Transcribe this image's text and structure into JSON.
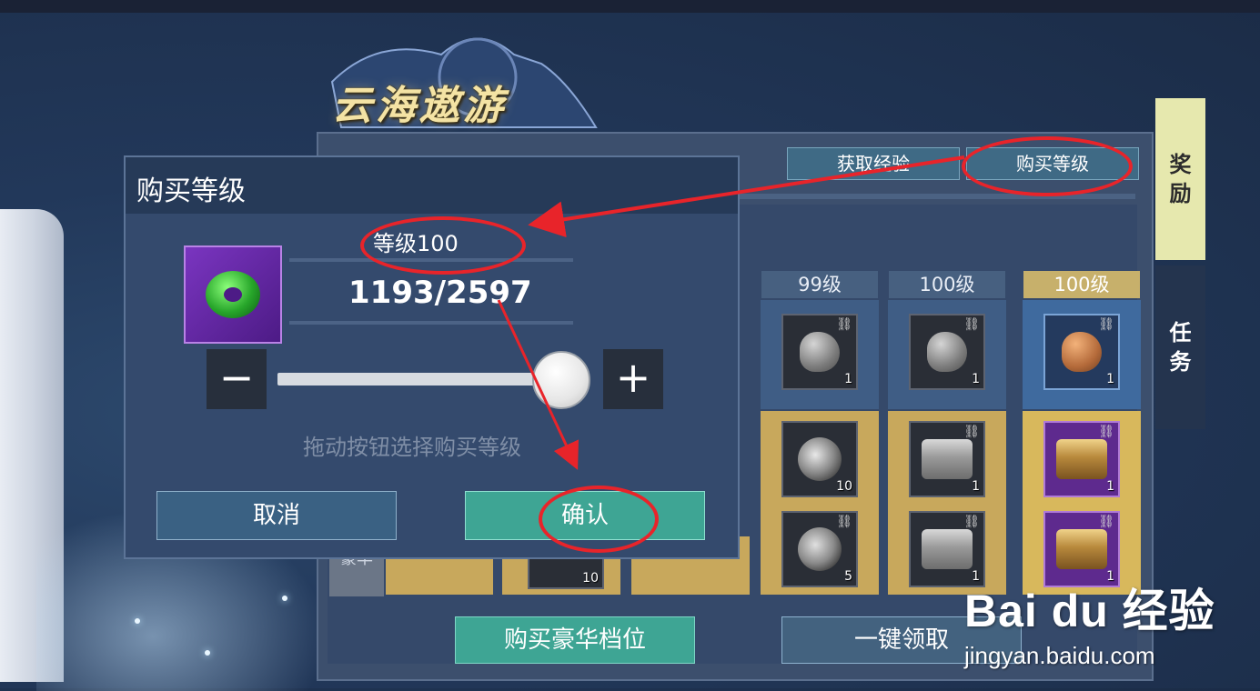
{
  "game": {
    "logo_text": "云海遨游"
  },
  "top_tabs": {
    "gain_exp": "获取经验",
    "buy_level": "购买等级"
  },
  "side_tabs": {
    "reward": "奖\n励",
    "task": "任\n务"
  },
  "columns": [
    {
      "header": "99级"
    },
    {
      "header": "100级"
    },
    {
      "header": "100级"
    }
  ],
  "rewards": {
    "row1": [
      {
        "icon": "grey-rock-icon",
        "count": "1"
      },
      {
        "icon": "grey-rock-icon",
        "count": "1"
      },
      {
        "icon": "orange-rock-icon",
        "count": "1"
      }
    ],
    "row2": [
      {
        "icon": "swirl-token-icon",
        "count": "10"
      },
      {
        "icon": "silver-chest-icon",
        "count": "1"
      },
      {
        "icon": "gold-chest-icon",
        "count": "1"
      }
    ],
    "row3": [
      {
        "icon": "jade-ring-icon",
        "count": "10"
      },
      {
        "icon": "silver-ring-icon",
        "count": "5"
      },
      {
        "icon": "silver-chest-icon",
        "count": "1"
      },
      {
        "icon": "gold-chest-icon",
        "count": "1"
      }
    ],
    "row_label": "豪华"
  },
  "bottom_buttons": {
    "buy_deluxe": "购买豪华档位",
    "claim_all": "一键领取"
  },
  "dialog": {
    "title": "购买等级",
    "level_label": "等级100",
    "exp": "1193/2597",
    "minus": "−",
    "plus": "+",
    "hint": "拖动按钮选择购买等级",
    "cancel": "取消",
    "confirm": "确认",
    "slider_fraction": 0.93
  },
  "watermark": {
    "brand": "Bai du 经验",
    "url": "jingyan.baidu.com"
  },
  "colors": {
    "accent_teal": "#3ea594",
    "annotation_red": "#e8242a",
    "gold": "#c8a85c"
  }
}
